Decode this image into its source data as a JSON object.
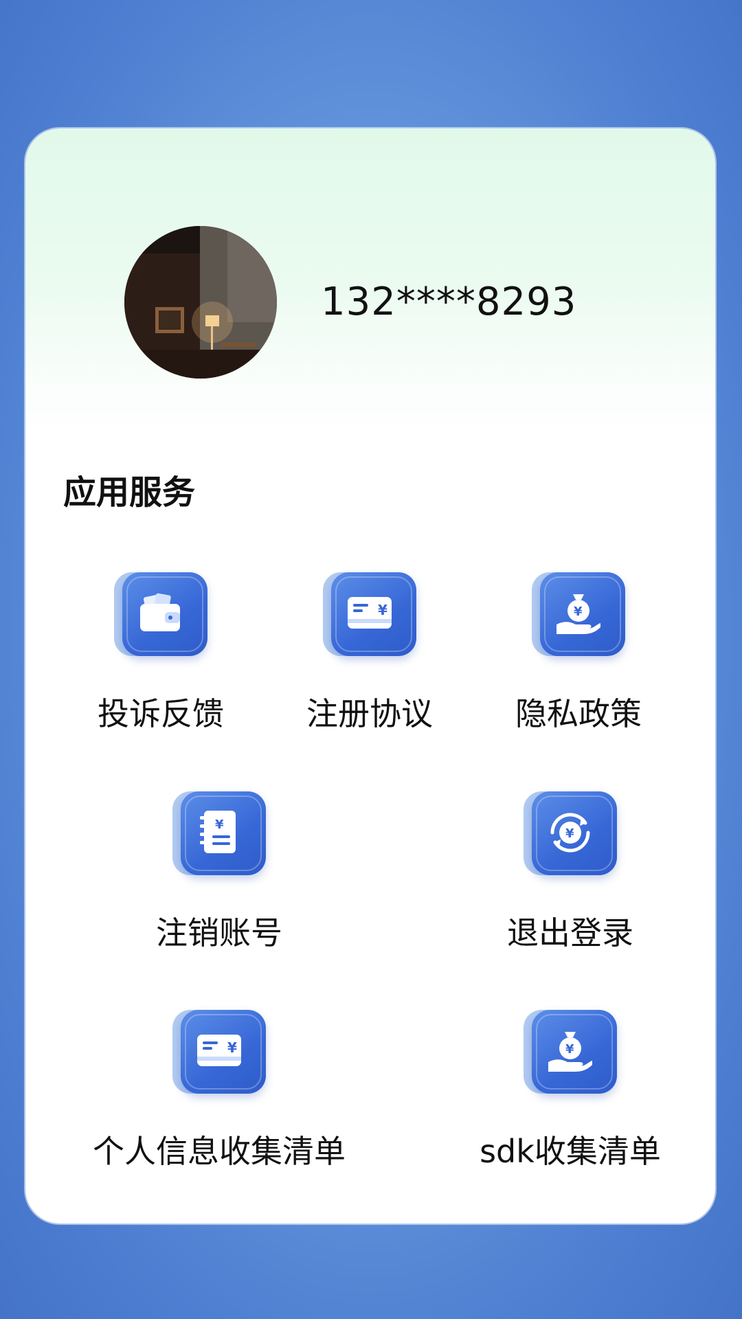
{
  "profile": {
    "phone": "132****8293"
  },
  "section": {
    "title": "应用服务"
  },
  "services": [
    {
      "label": "投诉反馈",
      "icon": "wallet-icon"
    },
    {
      "label": "注册协议",
      "icon": "card-icon"
    },
    {
      "label": "隐私政策",
      "icon": "money-bag-hand-icon"
    },
    {
      "label": "注销账号",
      "icon": "ledger-icon"
    },
    {
      "label": "退出登录",
      "icon": "refresh-coin-icon"
    },
    {
      "label": "个人信息收集清单",
      "icon": "card-icon"
    },
    {
      "label": "sdk收集清单",
      "icon": "money-bag-hand-icon"
    }
  ],
  "colors": {
    "icon_blue": "#3767d6",
    "background_blue": "#4f80d2"
  }
}
